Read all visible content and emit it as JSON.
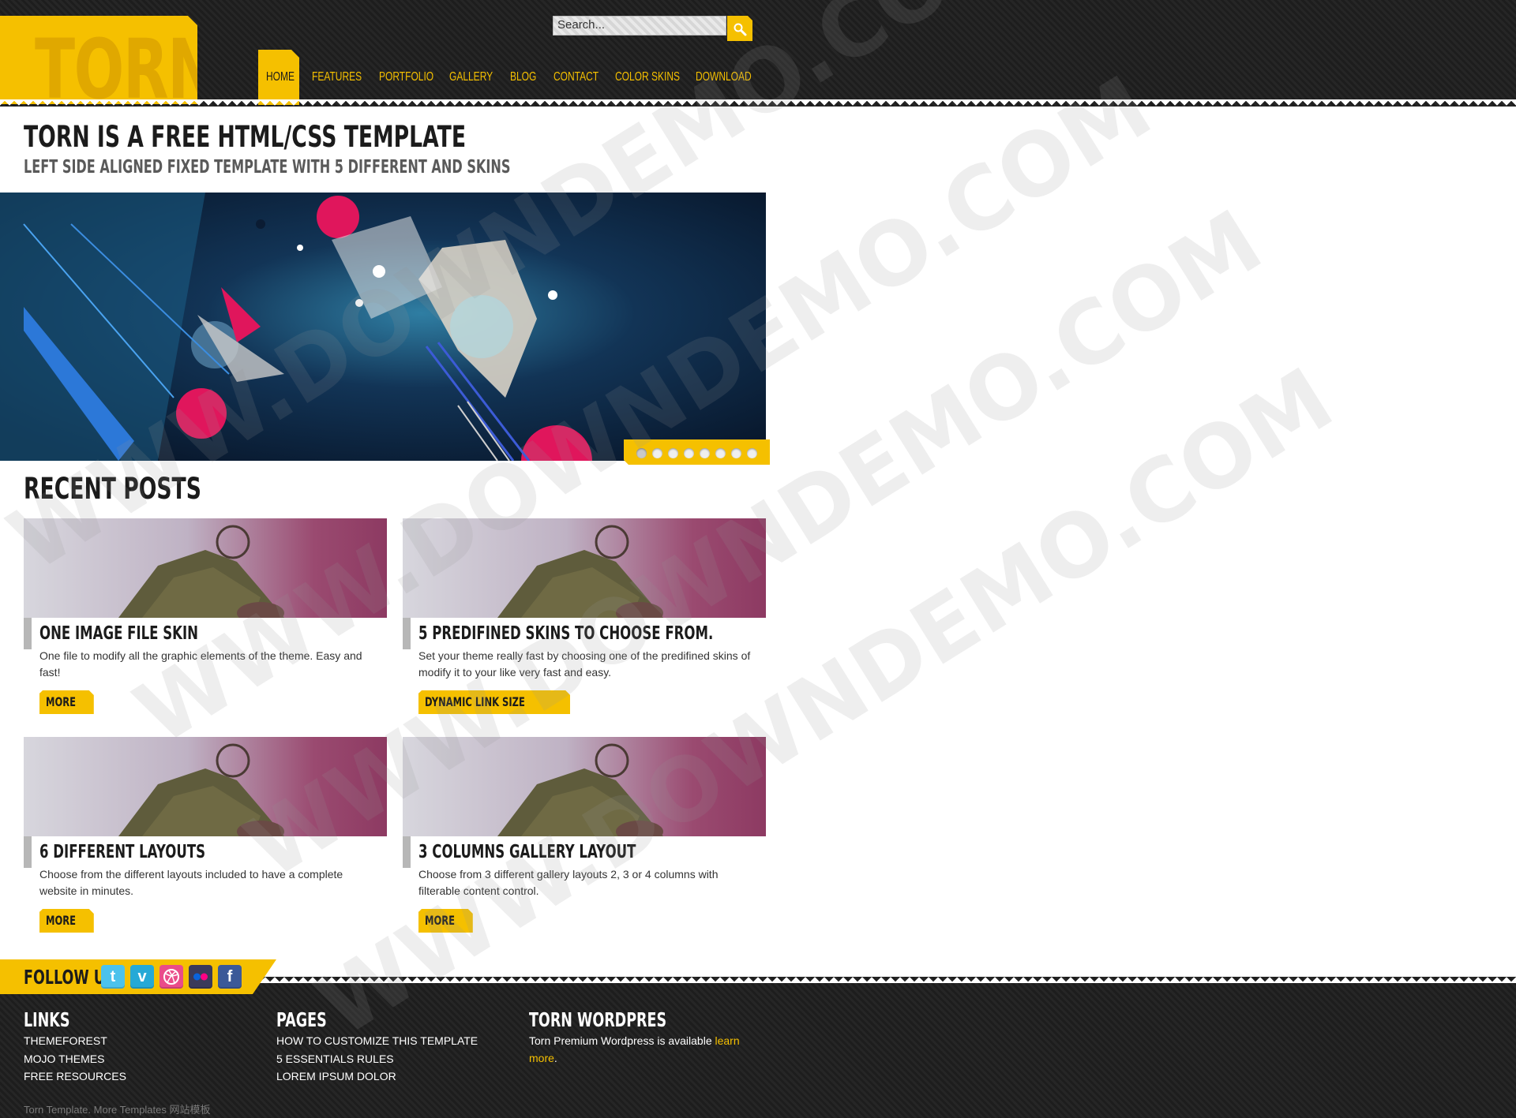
{
  "brand": {
    "logo_text": "TORN",
    "accent": "#f5c000",
    "dark": "#1b1b1b"
  },
  "search": {
    "value": "Search..."
  },
  "nav": {
    "items": [
      {
        "label": "HOME",
        "active": true
      },
      {
        "label": "FEATURES"
      },
      {
        "label": "PORTFOLIO"
      },
      {
        "label": "GALLERY"
      },
      {
        "label": "BLOG"
      },
      {
        "label": "CONTACT"
      },
      {
        "label": "COLOR SKINS"
      },
      {
        "label": "DOWNLOAD"
      }
    ]
  },
  "intro": {
    "title": "TORN IS A FREE HTML/CSS TEMPLATE",
    "subtitle": "LEFT SIDE ALIGNED FIXED TEMPLATE WITH 5 DIFFERENT AND SKINS"
  },
  "slider": {
    "active_slide": 1,
    "slide_count": 8
  },
  "recent_posts": {
    "title": "RECENT POSTS",
    "posts": [
      {
        "title": "ONE IMAGE FILE SKIN",
        "text": "One file to modify all the graphic elements of the theme. Easy and fast!",
        "button": "MORE"
      },
      {
        "title": "5 PREDIFINED SKINS TO CHOOSE FROM.",
        "text": "Set your theme really fast by choosing one of the predifined skins of modify it to your like very fast and easy.",
        "button": "DYNAMIC LINK SIZE"
      },
      {
        "title": "6 DIFFERENT LAYOUTS",
        "text": "Choose from the different layouts included to have a complete website in minutes.",
        "button": "MORE"
      },
      {
        "title": "3 COLUMNS GALLERY LAYOUT",
        "text": "Choose from 3 different gallery layouts 2, 3 or 4 columns with filterable content control.",
        "button": "MORE"
      }
    ]
  },
  "follow": {
    "label": "FOLLOW US",
    "icons": [
      "twitter-icon",
      "vimeo-icon",
      "dribbble-icon",
      "flickr-icon",
      "facebook-icon"
    ]
  },
  "footer": {
    "links": {
      "title": "LINKS",
      "items": [
        "THEMEFOREST",
        "MOJO THEMES",
        "FREE RESOURCES"
      ]
    },
    "pages": {
      "title": "PAGES",
      "items": [
        "HOW TO CUSTOMIZE THIS TEMPLATE",
        "5 ESSENTIALS RULES",
        "LOREM IPSUM DOLOR"
      ]
    },
    "wordpress": {
      "title": "TORN WORDPRES",
      "text": "Torn Premium Wordpress is available ",
      "link": "learn more",
      "suffix": "."
    },
    "copyright": "Torn Template. More Templates 网站模板"
  },
  "watermark": "WWW.DOWNDEMO.COM"
}
